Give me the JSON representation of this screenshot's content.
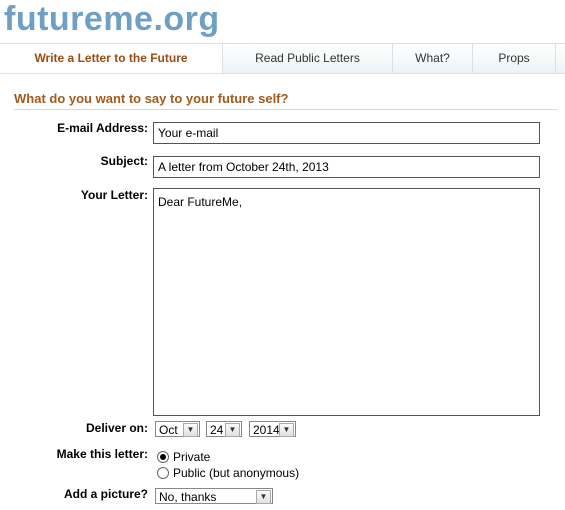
{
  "site": {
    "logo": "futureme.org"
  },
  "nav": {
    "tabs": [
      {
        "label": "Write a Letter to the Future",
        "active": true
      },
      {
        "label": "Read Public Letters",
        "active": false
      },
      {
        "label": "What?",
        "active": false
      },
      {
        "label": "Props",
        "active": false
      }
    ]
  },
  "form": {
    "heading": "What do you want to say to your future self?",
    "email": {
      "label": "E-mail Address:",
      "value": "Your e-mail"
    },
    "subject": {
      "label": "Subject:",
      "value": "A letter from October 24th, 2013"
    },
    "letter": {
      "label": "Your Letter:",
      "value": "Dear FutureMe,"
    },
    "deliver": {
      "label": "Deliver on:",
      "month": "Oct",
      "day": "24",
      "year": "2014"
    },
    "privacy": {
      "label": "Make this letter:",
      "options": [
        {
          "label": "Private",
          "checked": true
        },
        {
          "label": "Public (but anonymous)",
          "checked": false
        }
      ]
    },
    "picture": {
      "label": "Add a picture?",
      "value": "No, thanks"
    }
  },
  "colors": {
    "logo": "#6fa0c4",
    "accent": "#a35a1c"
  }
}
